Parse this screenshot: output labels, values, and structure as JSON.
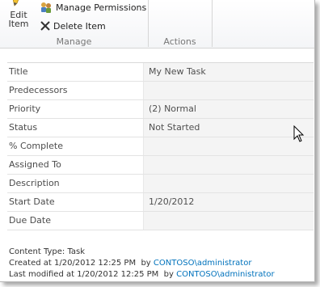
{
  "ribbon": {
    "edit_item_label_1": "Edit",
    "edit_item_label_2": "Item",
    "manage_permissions_label": "Manage Permissions",
    "delete_item_label": "Delete Item",
    "group_manage": "Manage",
    "group_actions": "Actions"
  },
  "fields": [
    {
      "label": "Title",
      "value": "My New Task"
    },
    {
      "label": "Predecessors",
      "value": ""
    },
    {
      "label": "Priority",
      "value": "(2) Normal"
    },
    {
      "label": "Status",
      "value": "Not Started"
    },
    {
      "label": "% Complete",
      "value": ""
    },
    {
      "label": "Assigned To",
      "value": ""
    },
    {
      "label": "Description",
      "value": ""
    },
    {
      "label": "Start Date",
      "value": "1/20/2012"
    },
    {
      "label": "Due Date",
      "value": ""
    }
  ],
  "footer": {
    "content_type": "Content Type: Task",
    "created_prefix": "Created at 1/20/2012 12:25 PM  by ",
    "created_domain": "CONTOSO",
    "created_user": "administrator",
    "modified_prefix": "Last modified at 1/20/2012 12:25 PM  by ",
    "modified_domain": "CONTOSO",
    "modified_user": "administrator"
  },
  "colors": {
    "link": "#0072bc"
  },
  "icons": {
    "edit_item": "pencil-icon",
    "manage_permissions": "permissions-icon",
    "delete_item": "delete-x-icon",
    "cursor": "mouse-pointer-icon"
  }
}
